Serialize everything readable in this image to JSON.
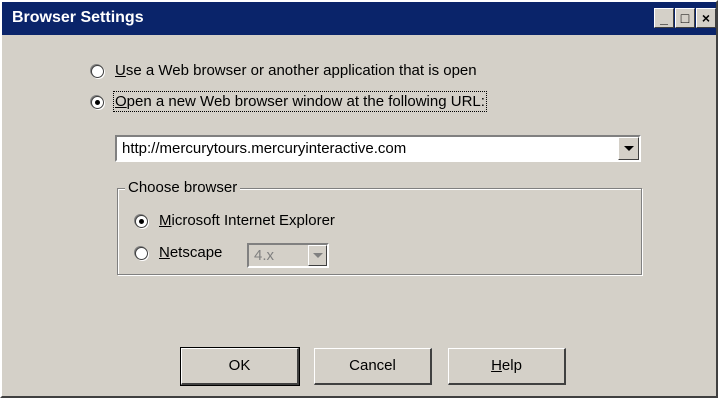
{
  "window": {
    "title": "Browser Settings",
    "controls": {
      "minimize": "_",
      "maximize": "□",
      "close": "×"
    }
  },
  "options": {
    "use_open_app": {
      "accesskey": "U",
      "rest": "se a Web browser or another application that is open",
      "checked": false
    },
    "open_new_window": {
      "accesskey": "O",
      "rest": "pen a new Web browser window at the following URL:",
      "checked": true
    }
  },
  "url_combo": {
    "value": "http://mercurytours.mercuryinteractive.com"
  },
  "choose_browser": {
    "legend": "Choose browser",
    "ie": {
      "accesskey": "M",
      "rest": "icrosoft Internet Explorer",
      "checked": true
    },
    "netscape": {
      "accesskey": "N",
      "rest": "etscape",
      "checked": false
    },
    "netscape_version": "4.x"
  },
  "buttons": {
    "ok": "OK",
    "cancel": "Cancel",
    "help_accesskey": "H",
    "help_rest": "elp"
  }
}
